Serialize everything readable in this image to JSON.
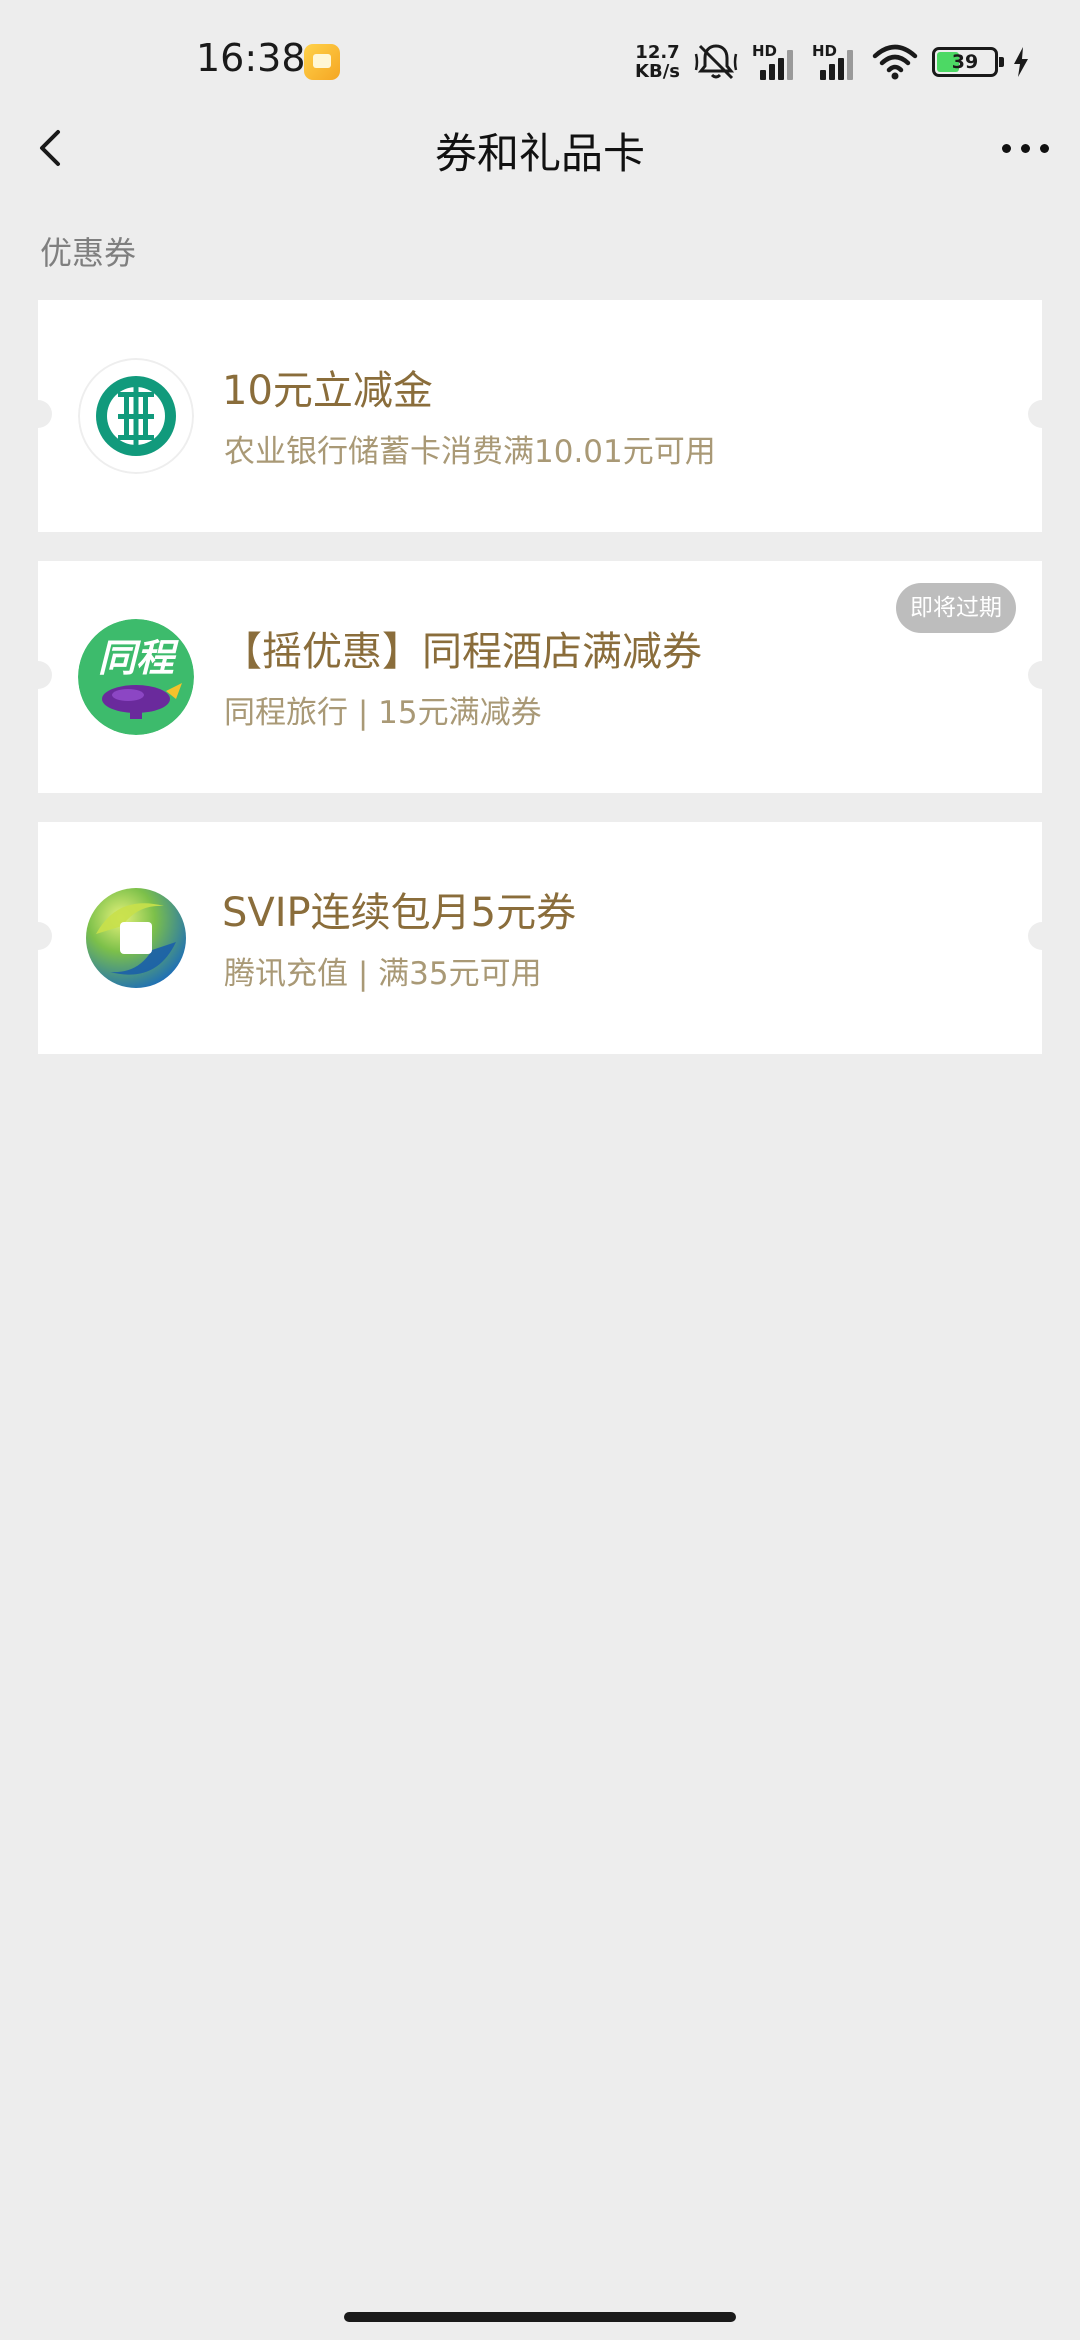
{
  "status_bar": {
    "time": "16:38",
    "net_speed_value": "12.7",
    "net_speed_unit": "KB/s",
    "hd_label_1": "HD",
    "hd_label_2": "HD",
    "battery_level": "39",
    "battery_fill_percent": 39
  },
  "nav": {
    "title": "券和礼品卡"
  },
  "section": {
    "title": "优惠券"
  },
  "coupons": [
    {
      "title": "10元立减金",
      "subtitle": "农业银行储蓄卡消费满10.01元可用",
      "logo": "abc-bank-logo"
    },
    {
      "title": "【摇优惠】同程酒店满减券",
      "subtitle": "同程旅行 | 15元满减券",
      "logo": "tongcheng-logo",
      "logo_text": "同程",
      "badge": "即将过期"
    },
    {
      "title": "SVIP连续包月5元券",
      "subtitle": "腾讯充值 | 满35元可用",
      "logo": "tencent-recharge-logo"
    }
  ],
  "colors": {
    "background": "#ededed",
    "card": "#ffffff",
    "coupon_title": "#8a6d3b",
    "coupon_subtitle": "#a99976",
    "badge_bg": "#bdbdbd"
  }
}
